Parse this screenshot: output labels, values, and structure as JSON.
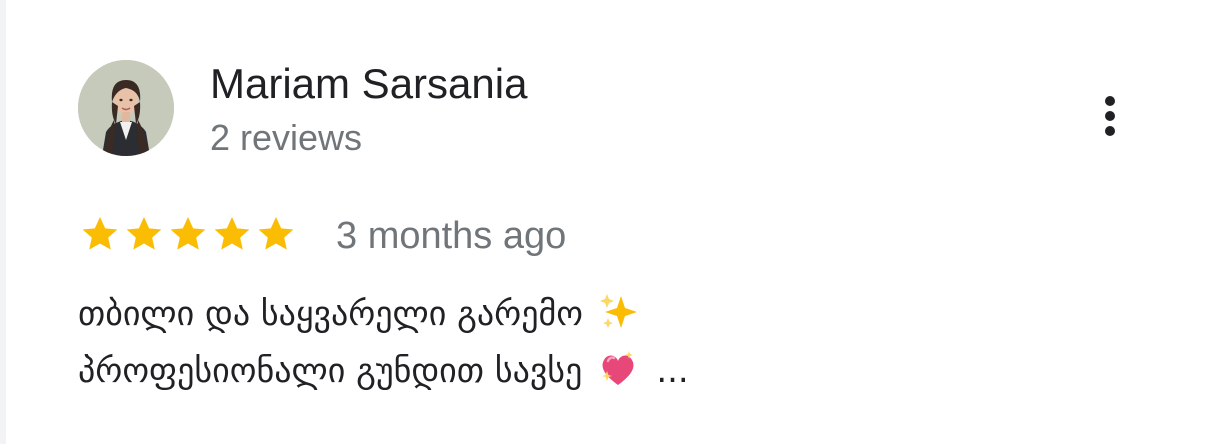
{
  "review": {
    "author_name": "Mariam Sarsania",
    "author_reviews": "2 reviews",
    "rating": 5,
    "rating_max": 5,
    "date": "3 months ago",
    "text_line_1": "თბილი და საყვარელი გარემო",
    "text_line_2": "პროფესიონალი გუნდით სავსე",
    "truncation": "...",
    "line_1_emoji": "sparkles-icon",
    "line_2_emoji": "sparkling-heart-icon",
    "more_button_icon": "more-vert-icon",
    "star_color": "#fbbc04"
  }
}
